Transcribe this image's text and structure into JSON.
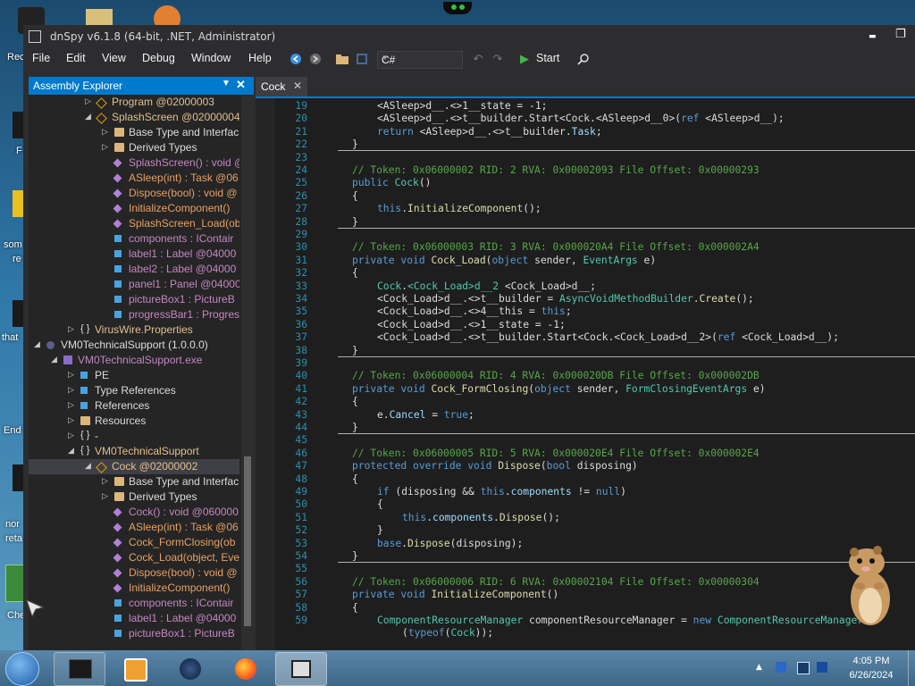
{
  "desktop": {
    "labels": [
      "Rec",
      "F",
      "som",
      "re",
      "that",
      "End",
      "nor",
      "reta",
      "Che"
    ]
  },
  "window": {
    "title": "dnSpy v6.1.8 (64-bit, .NET, Administrator)",
    "minimize": "▬",
    "restore": "❐"
  },
  "menu": [
    "File",
    "Edit",
    "View",
    "Debug",
    "Window",
    "Help"
  ],
  "toolbar": {
    "language": "C#",
    "start_label": "Start"
  },
  "explorer": {
    "title": "Assembly Explorer",
    "items": [
      {
        "label": "Program @02000003",
        "depth": 3,
        "arrow": "▷",
        "icon": "cls",
        "color": "c-yel"
      },
      {
        "label": "SplashScreen @02000004",
        "depth": 3,
        "arrow": "◢",
        "icon": "cls",
        "color": "c-yel"
      },
      {
        "label": "Base Type and Interfac",
        "depth": 4,
        "arrow": "▷",
        "icon": "folder",
        "color": ""
      },
      {
        "label": "Derived Types",
        "depth": 4,
        "arrow": "▷",
        "icon": "folder",
        "color": ""
      },
      {
        "label": "SplashScreen() : void @",
        "depth": 4,
        "arrow": "",
        "icon": "method",
        "color": "c-pur"
      },
      {
        "label": "ASleep(int) : Task @06",
        "depth": 4,
        "arrow": "",
        "icon": "method",
        "color": "c-org"
      },
      {
        "label": "Dispose(bool) : void @",
        "depth": 4,
        "arrow": "",
        "icon": "method",
        "color": "c-org"
      },
      {
        "label": "InitializeComponent()",
        "depth": 4,
        "arrow": "",
        "icon": "method",
        "color": "c-org"
      },
      {
        "label": "SplashScreen_Load(ob",
        "depth": 4,
        "arrow": "",
        "icon": "method",
        "color": "c-org"
      },
      {
        "label": "components : IContair",
        "depth": 4,
        "arrow": "",
        "icon": "field",
        "color": "c-pur"
      },
      {
        "label": "label1 : Label @04000",
        "depth": 4,
        "arrow": "",
        "icon": "field",
        "color": "c-pur"
      },
      {
        "label": "label2 : Label @04000",
        "depth": 4,
        "arrow": "",
        "icon": "field",
        "color": "c-pur"
      },
      {
        "label": "panel1 : Panel @04000",
        "depth": 4,
        "arrow": "",
        "icon": "field",
        "color": "c-pur"
      },
      {
        "label": "pictureBox1 : PictureB",
        "depth": 4,
        "arrow": "",
        "icon": "field",
        "color": "c-pur"
      },
      {
        "label": "progressBar1 : Progres",
        "depth": 4,
        "arrow": "",
        "icon": "field",
        "color": "c-pur"
      },
      {
        "label": "VirusWire.Properties",
        "depth": 2,
        "arrow": "▷",
        "icon": "ns",
        "color": "c-yel"
      },
      {
        "label": "VM0TechnicalSupport (1.0.0.0)",
        "depth": 0,
        "arrow": "◢",
        "icon": "gear",
        "color": ""
      },
      {
        "label": "VM0TechnicalSupport.exe",
        "depth": 1,
        "arrow": "◢",
        "icon": "asm",
        "color": "c-pur"
      },
      {
        "label": "PE",
        "depth": 2,
        "arrow": "▷",
        "icon": "field",
        "color": ""
      },
      {
        "label": "Type References",
        "depth": 2,
        "arrow": "▷",
        "icon": "field",
        "color": ""
      },
      {
        "label": "References",
        "depth": 2,
        "arrow": "▷",
        "icon": "field",
        "color": ""
      },
      {
        "label": "Resources",
        "depth": 2,
        "arrow": "▷",
        "icon": "folder",
        "color": ""
      },
      {
        "label": "-",
        "depth": 2,
        "arrow": "▷",
        "icon": "ns",
        "color": ""
      },
      {
        "label": "VM0TechnicalSupport",
        "depth": 2,
        "arrow": "◢",
        "icon": "ns",
        "color": "c-yel"
      },
      {
        "label": "Cock @02000002",
        "depth": 3,
        "arrow": "◢",
        "icon": "cls",
        "color": "c-yel",
        "selected": true
      },
      {
        "label": "Base Type and Interfac",
        "depth": 4,
        "arrow": "▷",
        "icon": "folder",
        "color": ""
      },
      {
        "label": "Derived Types",
        "depth": 4,
        "arrow": "▷",
        "icon": "folder",
        "color": ""
      },
      {
        "label": "Cock() : void @060000",
        "depth": 4,
        "arrow": "",
        "icon": "method",
        "color": "c-pur"
      },
      {
        "label": "ASleep(int) : Task @06",
        "depth": 4,
        "arrow": "",
        "icon": "method",
        "color": "c-org"
      },
      {
        "label": "Cock_FormClosing(ob",
        "depth": 4,
        "arrow": "",
        "icon": "method",
        "color": "c-org"
      },
      {
        "label": "Cock_Load(object, Eve",
        "depth": 4,
        "arrow": "",
        "icon": "method",
        "color": "c-org"
      },
      {
        "label": "Dispose(bool) : void @",
        "depth": 4,
        "arrow": "",
        "icon": "method",
        "color": "c-org"
      },
      {
        "label": "InitializeComponent()",
        "depth": 4,
        "arrow": "",
        "icon": "method",
        "color": "c-org"
      },
      {
        "label": "components : IContair",
        "depth": 4,
        "arrow": "",
        "icon": "field",
        "color": "c-pur"
      },
      {
        "label": "label1 : Label @04000",
        "depth": 4,
        "arrow": "",
        "icon": "field",
        "color": "c-pur"
      },
      {
        "label": "pictureBox1 : PictureB",
        "depth": 4,
        "arrow": "",
        "icon": "field",
        "color": "c-pur"
      }
    ]
  },
  "editor": {
    "tab_label": "Cock",
    "lines": [
      {
        "n": "19",
        "indent": 2,
        "segs": [
          [
            "",
            "<ASleep>d__.<>1__state = -1;"
          ]
        ]
      },
      {
        "n": "20",
        "indent": 2,
        "segs": [
          [
            "",
            "<ASleep>d__.<>t__builder.Start<Cock.<ASleep>d__0>("
          ],
          [
            "kw",
            "ref"
          ],
          [
            "",
            " <ASleep>d__);"
          ]
        ]
      },
      {
        "n": "21",
        "indent": 2,
        "segs": [
          [
            "kw",
            "return"
          ],
          [
            "",
            " <ASleep>d__.<>t__builder."
          ],
          [
            "pr",
            "Task"
          ],
          [
            "",
            ";"
          ]
        ]
      },
      {
        "n": "22",
        "indent": 1,
        "segs": [
          [
            "",
            "}"
          ]
        ],
        "sep": true
      },
      {
        "n": "23",
        "indent": 0,
        "segs": []
      },
      {
        "n": "24",
        "indent": 1,
        "segs": [
          [
            "cm",
            "// Token: 0x06000002 RID: 2 RVA: 0x00002093 File Offset: 0x00000293"
          ]
        ]
      },
      {
        "n": "25",
        "indent": 1,
        "segs": [
          [
            "kw",
            "public"
          ],
          [
            "",
            " "
          ],
          [
            "ty",
            "Cock"
          ],
          [
            "",
            "()"
          ]
        ]
      },
      {
        "n": "26",
        "indent": 1,
        "segs": [
          [
            "",
            "{"
          ]
        ]
      },
      {
        "n": "27",
        "indent": 2,
        "segs": [
          [
            "kw",
            "this"
          ],
          [
            "",
            "."
          ],
          [
            "mt",
            "InitializeComponent"
          ],
          [
            "",
            "();"
          ]
        ]
      },
      {
        "n": "28",
        "indent": 1,
        "segs": [
          [
            "",
            "}"
          ]
        ],
        "sep": true
      },
      {
        "n": "29",
        "indent": 0,
        "segs": []
      },
      {
        "n": "30",
        "indent": 1,
        "segs": [
          [
            "cm",
            "// Token: 0x06000003 RID: 3 RVA: 0x000020A4 File Offset: 0x000002A4"
          ]
        ]
      },
      {
        "n": "31",
        "indent": 1,
        "segs": [
          [
            "kw",
            "private void"
          ],
          [
            "",
            " "
          ],
          [
            "mt",
            "Cock_Load"
          ],
          [
            "",
            "("
          ],
          [
            "kw",
            "object"
          ],
          [
            "",
            " sender, "
          ],
          [
            "ty",
            "EventArgs"
          ],
          [
            "",
            " e)"
          ]
        ]
      },
      {
        "n": "32",
        "indent": 1,
        "segs": [
          [
            "",
            "{"
          ]
        ]
      },
      {
        "n": "33",
        "indent": 2,
        "segs": [
          [
            "ty",
            "Cock"
          ],
          [
            "",
            "."
          ],
          [
            "ty",
            "<Cock_Load>d__2"
          ],
          [
            "",
            " <Cock_Load>d__;"
          ]
        ]
      },
      {
        "n": "34",
        "indent": 2,
        "segs": [
          [
            "",
            "<Cock_Load>d__.<>t__builder = "
          ],
          [
            "ty",
            "AsyncVoidMethodBuilder"
          ],
          [
            "",
            "."
          ],
          [
            "mt",
            "Create"
          ],
          [
            "",
            "();"
          ]
        ]
      },
      {
        "n": "35",
        "indent": 2,
        "segs": [
          [
            "",
            "<Cock_Load>d__.<>4__this = "
          ],
          [
            "kw",
            "this"
          ],
          [
            "",
            ";"
          ]
        ]
      },
      {
        "n": "36",
        "indent": 2,
        "segs": [
          [
            "",
            "<Cock_Load>d__.<>1__state = -1;"
          ]
        ]
      },
      {
        "n": "37",
        "indent": 2,
        "segs": [
          [
            "",
            "<Cock_Load>d__.<>t__builder.Start<Cock.<Cock_Load>d__2>("
          ],
          [
            "kw",
            "ref"
          ],
          [
            "",
            " <Cock_Load>d__);"
          ]
        ]
      },
      {
        "n": "38",
        "indent": 1,
        "segs": [
          [
            "",
            "}"
          ]
        ],
        "sep": true
      },
      {
        "n": "39",
        "indent": 0,
        "segs": []
      },
      {
        "n": "40",
        "indent": 1,
        "segs": [
          [
            "cm",
            "// Token: 0x06000004 RID: 4 RVA: 0x000020DB File Offset: 0x000002DB"
          ]
        ]
      },
      {
        "n": "41",
        "indent": 1,
        "segs": [
          [
            "kw",
            "private void"
          ],
          [
            "",
            " "
          ],
          [
            "mt",
            "Cock_FormClosing"
          ],
          [
            "",
            "("
          ],
          [
            "kw",
            "object"
          ],
          [
            "",
            " sender, "
          ],
          [
            "ty",
            "FormClosingEventArgs"
          ],
          [
            "",
            " e)"
          ]
        ]
      },
      {
        "n": "42",
        "indent": 1,
        "segs": [
          [
            "",
            "{"
          ]
        ]
      },
      {
        "n": "43",
        "indent": 2,
        "segs": [
          [
            "",
            "e."
          ],
          [
            "pr",
            "Cancel"
          ],
          [
            "",
            " = "
          ],
          [
            "kw",
            "true"
          ],
          [
            "",
            ";"
          ]
        ]
      },
      {
        "n": "44",
        "indent": 1,
        "segs": [
          [
            "",
            "}"
          ]
        ],
        "sep": true
      },
      {
        "n": "45",
        "indent": 0,
        "segs": []
      },
      {
        "n": "46",
        "indent": 1,
        "segs": [
          [
            "cm",
            "// Token: 0x06000005 RID: 5 RVA: 0x000020E4 File Offset: 0x000002E4"
          ]
        ]
      },
      {
        "n": "47",
        "indent": 1,
        "segs": [
          [
            "kw",
            "protected override void"
          ],
          [
            "",
            " "
          ],
          [
            "mt",
            "Dispose"
          ],
          [
            "",
            "("
          ],
          [
            "kw",
            "bool"
          ],
          [
            "",
            " disposing)"
          ]
        ]
      },
      {
        "n": "48",
        "indent": 1,
        "segs": [
          [
            "",
            "{"
          ]
        ]
      },
      {
        "n": "49",
        "indent": 2,
        "segs": [
          [
            "kw",
            "if"
          ],
          [
            "",
            " (disposing && "
          ],
          [
            "kw",
            "this"
          ],
          [
            "",
            "."
          ],
          [
            "pr",
            "components"
          ],
          [
            "",
            " != "
          ],
          [
            "kw",
            "null"
          ],
          [
            "",
            ")"
          ]
        ]
      },
      {
        "n": "50",
        "indent": 2,
        "segs": [
          [
            "",
            "{"
          ]
        ]
      },
      {
        "n": "51",
        "indent": 3,
        "segs": [
          [
            "kw",
            "this"
          ],
          [
            "",
            "."
          ],
          [
            "pr",
            "components"
          ],
          [
            "",
            "."
          ],
          [
            "mt",
            "Dispose"
          ],
          [
            "",
            "();"
          ]
        ]
      },
      {
        "n": "52",
        "indent": 2,
        "segs": [
          [
            "",
            "}"
          ]
        ]
      },
      {
        "n": "53",
        "indent": 2,
        "segs": [
          [
            "kw",
            "base"
          ],
          [
            "",
            "."
          ],
          [
            "mt",
            "Dispose"
          ],
          [
            "",
            "(disposing);"
          ]
        ]
      },
      {
        "n": "54",
        "indent": 1,
        "segs": [
          [
            "",
            "}"
          ]
        ],
        "sep": true
      },
      {
        "n": "55",
        "indent": 0,
        "segs": []
      },
      {
        "n": "56",
        "indent": 1,
        "segs": [
          [
            "cm",
            "// Token: 0x06000006 RID: 6 RVA: 0x00002104 File Offset: 0x00000304"
          ]
        ]
      },
      {
        "n": "57",
        "indent": 1,
        "segs": [
          [
            "kw",
            "private void"
          ],
          [
            "",
            " "
          ],
          [
            "mt",
            "InitializeComponent"
          ],
          [
            "",
            "()"
          ]
        ]
      },
      {
        "n": "58",
        "indent": 1,
        "segs": [
          [
            "",
            "{"
          ]
        ]
      },
      {
        "n": "59",
        "indent": 2,
        "segs": [
          [
            "ty",
            "ComponentResourceManager"
          ],
          [
            "",
            " componentResourceManager = "
          ],
          [
            "kw",
            "new"
          ],
          [
            "",
            " "
          ],
          [
            "ty",
            "ComponentResourceManager"
          ]
        ]
      },
      {
        "n": "",
        "indent": 3,
        "segs": [
          [
            "",
            "("
          ],
          [
            "kw",
            "typeof"
          ],
          [
            "",
            "("
          ],
          [
            "ty",
            "Cock"
          ],
          [
            "",
            "));"
          ]
        ]
      }
    ]
  },
  "taskbar": {
    "time": "4:05 PM",
    "date": "6/26/2024"
  }
}
